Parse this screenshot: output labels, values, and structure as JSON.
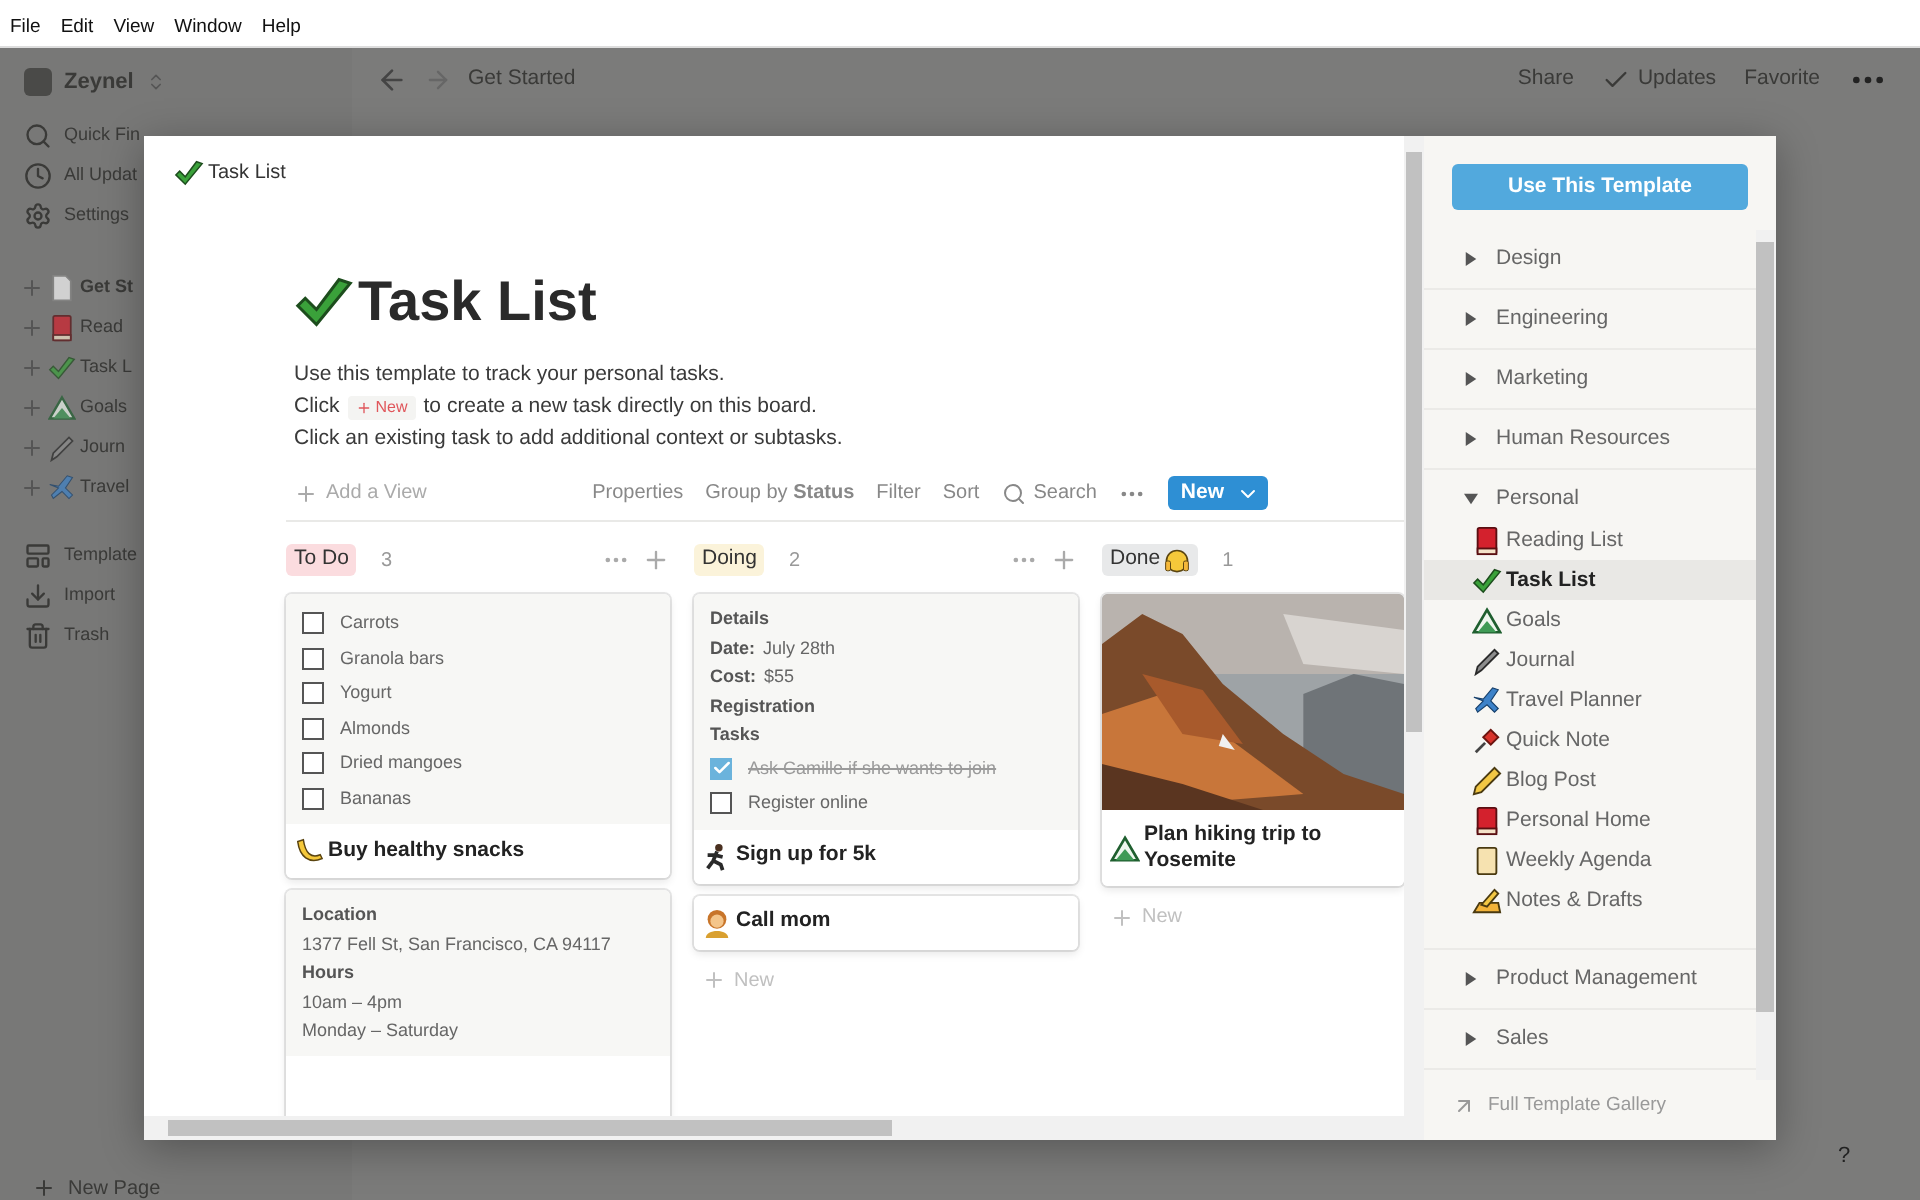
{
  "menu_bar": [
    "File",
    "Edit",
    "View",
    "Window",
    "Help"
  ],
  "sidebar": {
    "workspace": "Zeynel",
    "nav": [
      {
        "label": "Quick Fin",
        "kind": "search"
      },
      {
        "label": "All Updat",
        "kind": "clock"
      },
      {
        "label": "Settings",
        "kind": "gear"
      }
    ],
    "pages": [
      {
        "label": "Get St",
        "kind": "document"
      },
      {
        "label": "Read",
        "kind": "book"
      },
      {
        "label": "Task L",
        "kind": "check"
      },
      {
        "label": "Goals",
        "kind": "mountain"
      },
      {
        "label": "Journ",
        "kind": "pen"
      },
      {
        "label": "Travel",
        "kind": "plane"
      }
    ],
    "tools": [
      {
        "label": "Template",
        "kind": "template"
      },
      {
        "label": "Import",
        "kind": "import"
      },
      {
        "label": "Trash",
        "kind": "trash"
      }
    ],
    "new_page": "New Page"
  },
  "topbar": {
    "breadcrumb": "Get Started",
    "share": "Share",
    "updates": "Updates",
    "favorite": "Favorite"
  },
  "help": "?",
  "modal": {
    "breadcrumb": "Task List",
    "title": "Task List",
    "intro": "Use this template to track your personal tasks.",
    "click_line": {
      "before": "Click",
      "badge": "New",
      "after": "to create a new task directly on this board."
    },
    "outro": "Click an existing task to add additional context or subtasks.",
    "toolbar": {
      "add_view": "Add a View",
      "properties": "Properties",
      "group_by": "Group by **Status**",
      "filter": "Filter",
      "sort": "Sort",
      "search": "Search",
      "new": "New"
    },
    "columns": [
      {
        "name": "To Do",
        "color": "#fbdcdf",
        "count": "3",
        "actions": true,
        "cards": [
          {
            "title": "Buy healthy snacks",
            "lines": [
              {
                "kind": "checkbox",
                "text": "Carrots",
                "checked": false
              },
              {
                "kind": "checkbox",
                "text": "Granola bars",
                "checked": false
              },
              {
                "kind": "checkbox",
                "text": "Yogurt",
                "checked": false
              },
              {
                "kind": "checkbox",
                "text": "Almonds",
                "checked": false
              },
              {
                "kind": "checkbox",
                "text": "Dried mangoes",
                "checked": false
              },
              {
                "kind": "checkbox",
                "text": "Bananas",
                "checked": false
              }
            ]
          },
          {
            "lines": [
              {
                "kind": "heading",
                "text": "Location"
              },
              {
                "kind": "text",
                "text": "1377 Fell St, San Francisco, CA 94117"
              },
              {
                "kind": "heading",
                "text": "Hours"
              },
              {
                "kind": "text",
                "text": "10am – 4pm"
              },
              {
                "kind": "text",
                "text": "Monday – Saturday"
              }
            ]
          }
        ]
      },
      {
        "name": "Doing",
        "color": "#fbf3da",
        "count": "2",
        "actions": true,
        "add_new": "New",
        "cards": [
          {
            "title": "Sign up for 5k",
            "lines": [
              {
                "kind": "heading",
                "text": "Details"
              },
              {
                "kind": "field",
                "label": "Date:",
                "text": "July 28th"
              },
              {
                "kind": "field",
                "label": "Cost:",
                "text": "$55"
              },
              {
                "kind": "heading",
                "text": "Registration"
              },
              {
                "kind": "heading",
                "text": "Tasks"
              },
              {
                "kind": "checkbox",
                "text": "Ask Camille if she wants to join",
                "checked": true
              },
              {
                "kind": "checkbox",
                "text": "Register online",
                "checked": false
              }
            ]
          },
          {
            "title": "Call mom"
          }
        ]
      },
      {
        "name": "Done",
        "color": "#e8e9ea",
        "count": "1",
        "actions": false,
        "add_new": "New",
        "cards": [
          {
            "title": "Plan hiking trip to Yosemite"
          }
        ]
      }
    ]
  },
  "templates": {
    "button": "Use This Template",
    "categories": [
      {
        "name": "Design",
        "expanded": false
      },
      {
        "name": "Engineering",
        "expanded": false
      },
      {
        "name": "Marketing",
        "expanded": false
      },
      {
        "name": "Human Resources",
        "expanded": false
      },
      {
        "name": "Personal",
        "expanded": true,
        "children": [
          {
            "label": "Reading List",
            "kind": "book",
            "selected": false
          },
          {
            "label": "Task List",
            "kind": "check",
            "selected": true
          },
          {
            "label": "Goals",
            "kind": "mountain",
            "selected": false
          },
          {
            "label": "Journal",
            "kind": "pen",
            "selected": false
          },
          {
            "label": "Travel Planner",
            "kind": "plane",
            "selected": false
          },
          {
            "label": "Quick Note",
            "kind": "pin",
            "selected": false
          },
          {
            "label": "Blog Post",
            "kind": "pencil",
            "selected": false
          },
          {
            "label": "Personal Home",
            "kind": "book",
            "selected": false
          },
          {
            "label": "Weekly Agenda",
            "kind": "agenda",
            "selected": false
          },
          {
            "label": "Notes & Drafts",
            "kind": "notes",
            "selected": false
          }
        ]
      },
      {
        "name": "Product Management",
        "expanded": false
      },
      {
        "name": "Sales",
        "expanded": false
      }
    ],
    "gallery": "Full Template Gallery"
  }
}
